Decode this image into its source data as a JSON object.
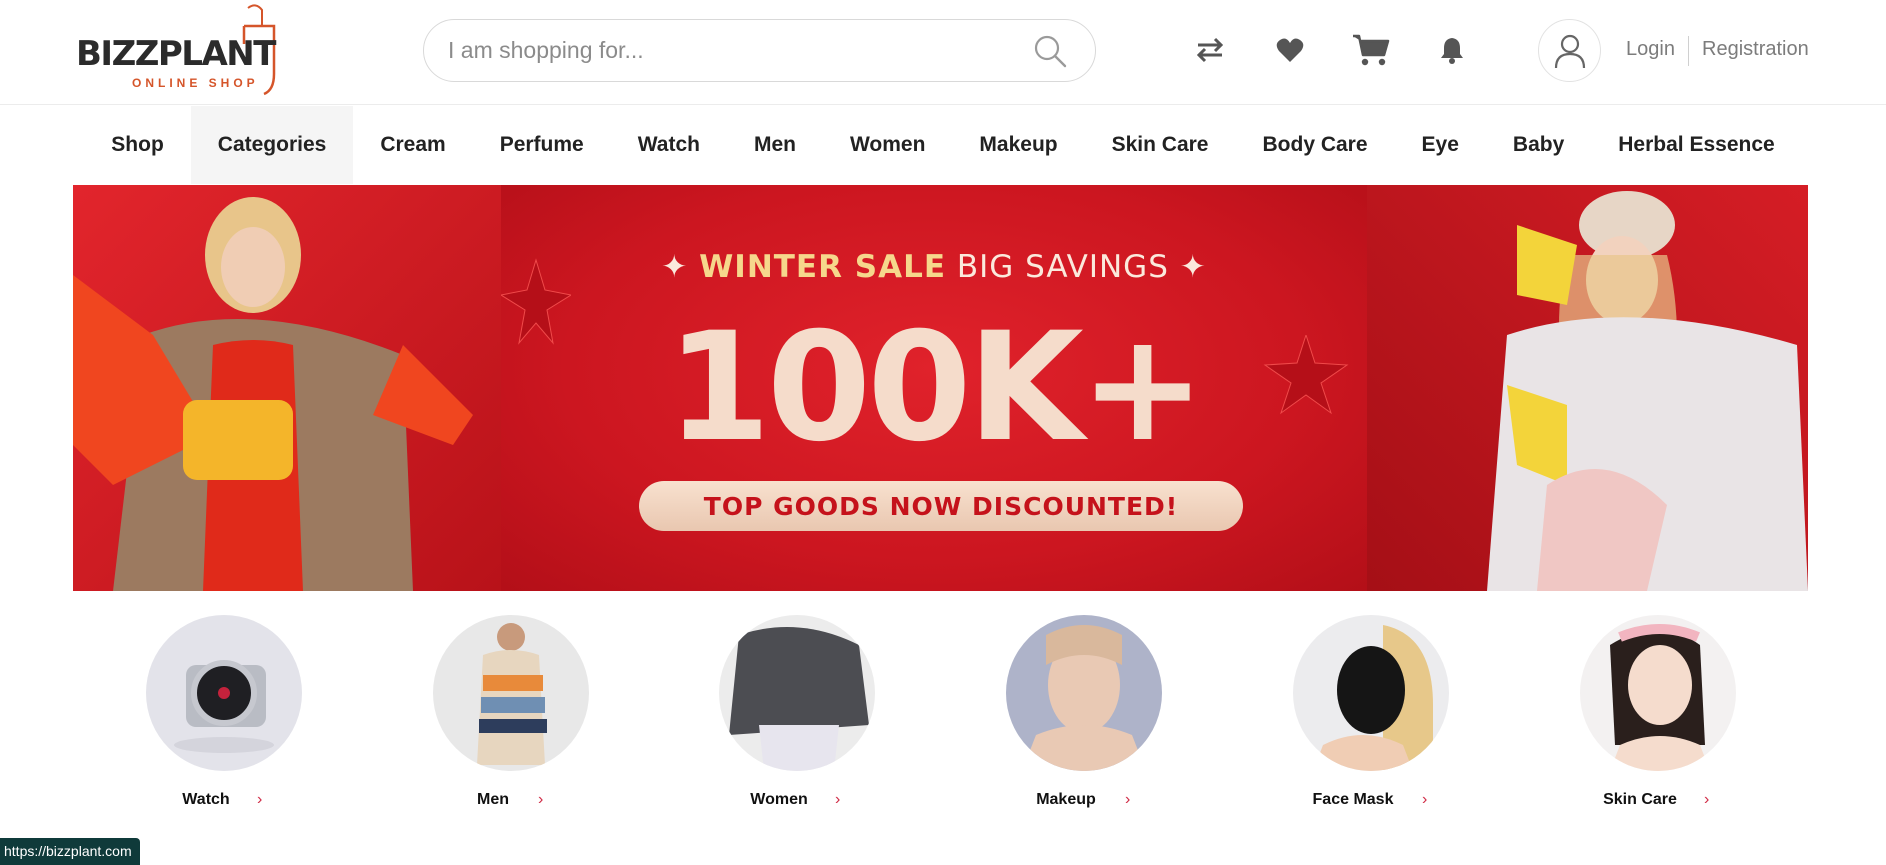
{
  "header": {
    "logo_text": "BIZZPLANT",
    "logo_subtext": "ONLINE SHOP",
    "search_placeholder": "I am shopping for...",
    "icons": [
      "compare-icon",
      "heart-icon",
      "cart-icon",
      "bell-icon",
      "user-icon"
    ],
    "login_label": "Login",
    "registration_label": "Registration"
  },
  "nav": {
    "items": [
      "Shop",
      "Categories",
      "Cream",
      "Perfume",
      "Watch",
      "Men",
      "Women",
      "Makeup",
      "Skin Care",
      "Body Care",
      "Eye",
      "Baby",
      "Herbal Essence"
    ],
    "active": "Categories"
  },
  "banner": {
    "line_highlight": "WINTER SALE",
    "line_rest": "BIG SAVINGS",
    "big_text": "100K+",
    "pill_text": "TOP GOODS NOW DISCOUNTED!"
  },
  "categories": [
    {
      "label": "Watch"
    },
    {
      "label": "Men"
    },
    {
      "label": "Women"
    },
    {
      "label": "Makeup"
    },
    {
      "label": "Face Mask"
    },
    {
      "label": "Skin Care"
    }
  ],
  "status_url": "https://bizzplant.com",
  "colors": {
    "brand_orange": "#d5552a",
    "banner_red": "#d51924",
    "chevron_pink": "#d02a45"
  }
}
